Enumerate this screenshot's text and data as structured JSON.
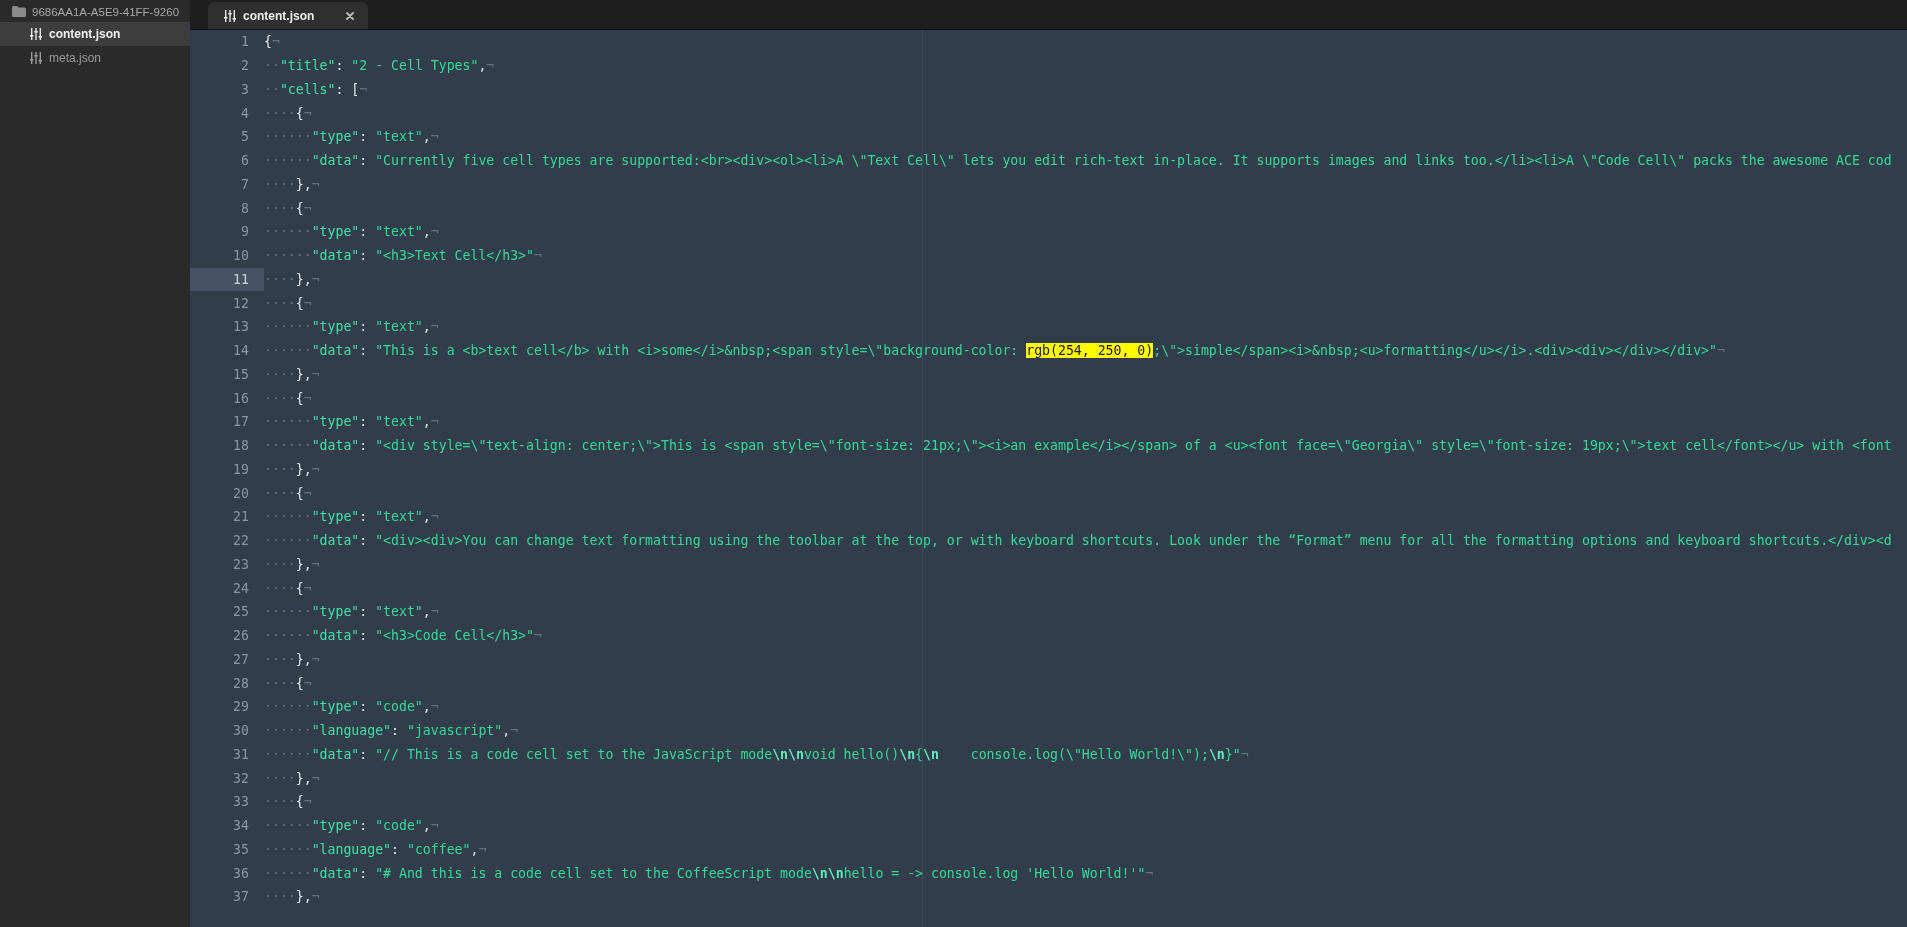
{
  "sidebar": {
    "folder": {
      "name": "9686AA1A-A5E9-41FF-9260"
    },
    "files": [
      {
        "name": "content.json",
        "selected": true
      },
      {
        "name": "meta.json",
        "selected": false
      }
    ]
  },
  "tabs": [
    {
      "label": "content.json",
      "selected": true
    }
  ],
  "editor": {
    "lines": [
      {
        "number": "1",
        "current": false,
        "tokens": [
          {
            "kind": "punct",
            "text": "{"
          },
          {
            "kind": "eol",
            "text": "¬"
          }
        ]
      },
      {
        "number": "2",
        "current": false,
        "tokens": [
          {
            "kind": "space",
            "text": "··"
          },
          {
            "kind": "key",
            "text": "\"title\""
          },
          {
            "kind": "punct",
            "text": ": "
          },
          {
            "kind": "string",
            "text": "\"2 - Cell Types\""
          },
          {
            "kind": "punct",
            "text": ","
          },
          {
            "kind": "eol",
            "text": "¬"
          }
        ]
      },
      {
        "number": "3",
        "current": false,
        "tokens": [
          {
            "kind": "space",
            "text": "··"
          },
          {
            "kind": "key",
            "text": "\"cells\""
          },
          {
            "kind": "punct",
            "text": ": ["
          },
          {
            "kind": "eol",
            "text": "¬"
          }
        ]
      },
      {
        "number": "4",
        "current": false,
        "tokens": [
          {
            "kind": "space",
            "text": "····"
          },
          {
            "kind": "punct",
            "text": "{"
          },
          {
            "kind": "eol",
            "text": "¬"
          }
        ]
      },
      {
        "number": "5",
        "current": false,
        "tokens": [
          {
            "kind": "space",
            "text": "······"
          },
          {
            "kind": "key",
            "text": "\"type\""
          },
          {
            "kind": "punct",
            "text": ": "
          },
          {
            "kind": "string",
            "text": "\"text\""
          },
          {
            "kind": "punct",
            "text": ","
          },
          {
            "kind": "eol",
            "text": "¬"
          }
        ]
      },
      {
        "number": "6",
        "current": false,
        "tokens": [
          {
            "kind": "space",
            "text": "······"
          },
          {
            "kind": "key",
            "text": "\"data\""
          },
          {
            "kind": "punct",
            "text": ": "
          },
          {
            "kind": "string",
            "text": "\"Currently five cell types are supported:<br><div><ol><li>A \\\"Text Cell\\\" lets you edit rich-text in-place. It supports images and links too.</li><li>A \\\"Code Cell\\\" packs the awesome ACE cod"
          }
        ]
      },
      {
        "number": "7",
        "current": false,
        "tokens": [
          {
            "kind": "space",
            "text": "····"
          },
          {
            "kind": "punct",
            "text": "},"
          },
          {
            "kind": "eol",
            "text": "¬"
          }
        ]
      },
      {
        "number": "8",
        "current": false,
        "tokens": [
          {
            "kind": "space",
            "text": "····"
          },
          {
            "kind": "punct",
            "text": "{"
          },
          {
            "kind": "eol",
            "text": "¬"
          }
        ]
      },
      {
        "number": "9",
        "current": false,
        "tokens": [
          {
            "kind": "space",
            "text": "······"
          },
          {
            "kind": "key",
            "text": "\"type\""
          },
          {
            "kind": "punct",
            "text": ": "
          },
          {
            "kind": "string",
            "text": "\"text\""
          },
          {
            "kind": "punct",
            "text": ","
          },
          {
            "kind": "eol",
            "text": "¬"
          }
        ]
      },
      {
        "number": "10",
        "current": false,
        "tokens": [
          {
            "kind": "space",
            "text": "······"
          },
          {
            "kind": "key",
            "text": "\"data\""
          },
          {
            "kind": "punct",
            "text": ": "
          },
          {
            "kind": "string",
            "text": "\"<h3>Text Cell</h3>\""
          },
          {
            "kind": "eol",
            "text": "¬"
          }
        ]
      },
      {
        "number": "11",
        "current": true,
        "tokens": [
          {
            "kind": "space",
            "text": "····"
          },
          {
            "kind": "punct",
            "text": "},"
          },
          {
            "kind": "eol",
            "text": "¬"
          }
        ]
      },
      {
        "number": "12",
        "current": false,
        "tokens": [
          {
            "kind": "space",
            "text": "····"
          },
          {
            "kind": "punct",
            "text": "{"
          },
          {
            "kind": "eol",
            "text": "¬"
          }
        ]
      },
      {
        "number": "13",
        "current": false,
        "tokens": [
          {
            "kind": "space",
            "text": "······"
          },
          {
            "kind": "key",
            "text": "\"type\""
          },
          {
            "kind": "punct",
            "text": ": "
          },
          {
            "kind": "string",
            "text": "\"text\""
          },
          {
            "kind": "punct",
            "text": ","
          },
          {
            "kind": "eol",
            "text": "¬"
          }
        ]
      },
      {
        "number": "14",
        "current": false,
        "tokens": [
          {
            "kind": "space",
            "text": "······"
          },
          {
            "kind": "key",
            "text": "\"data\""
          },
          {
            "kind": "punct",
            "text": ": "
          },
          {
            "kind": "string",
            "text": "\"This is a <b>text cell</b> with <i>some</i>&nbsp;<span style=\\\"background-color: "
          },
          {
            "kind": "highlight",
            "text": "rgb(254, 250, 0)"
          },
          {
            "kind": "string",
            "text": ";\\\">simple</span><i>&nbsp;<u>formatting</u></i>.<div><div></div></div>\""
          },
          {
            "kind": "eol",
            "text": "¬"
          }
        ]
      },
      {
        "number": "15",
        "current": false,
        "tokens": [
          {
            "kind": "space",
            "text": "····"
          },
          {
            "kind": "punct",
            "text": "},"
          },
          {
            "kind": "eol",
            "text": "¬"
          }
        ]
      },
      {
        "number": "16",
        "current": false,
        "tokens": [
          {
            "kind": "space",
            "text": "····"
          },
          {
            "kind": "punct",
            "text": "{"
          },
          {
            "kind": "eol",
            "text": "¬"
          }
        ]
      },
      {
        "number": "17",
        "current": false,
        "tokens": [
          {
            "kind": "space",
            "text": "······"
          },
          {
            "kind": "key",
            "text": "\"type\""
          },
          {
            "kind": "punct",
            "text": ": "
          },
          {
            "kind": "string",
            "text": "\"text\""
          },
          {
            "kind": "punct",
            "text": ","
          },
          {
            "kind": "eol",
            "text": "¬"
          }
        ]
      },
      {
        "number": "18",
        "current": false,
        "tokens": [
          {
            "kind": "space",
            "text": "······"
          },
          {
            "kind": "key",
            "text": "\"data\""
          },
          {
            "kind": "punct",
            "text": ": "
          },
          {
            "kind": "string",
            "text": "\"<div style=\\\"text-align: center;\\\">This is <span style=\\\"font-size: 21px;\\\"><i>an example</i></span> of a <u><font face=\\\"Georgia\\\" style=\\\"font-size: 19px;\\\">text cell</font></u> with <font"
          }
        ]
      },
      {
        "number": "19",
        "current": false,
        "tokens": [
          {
            "kind": "space",
            "text": "····"
          },
          {
            "kind": "punct",
            "text": "},"
          },
          {
            "kind": "eol",
            "text": "¬"
          }
        ]
      },
      {
        "number": "20",
        "current": false,
        "tokens": [
          {
            "kind": "space",
            "text": "····"
          },
          {
            "kind": "punct",
            "text": "{"
          },
          {
            "kind": "eol",
            "text": "¬"
          }
        ]
      },
      {
        "number": "21",
        "current": false,
        "tokens": [
          {
            "kind": "space",
            "text": "······"
          },
          {
            "kind": "key",
            "text": "\"type\""
          },
          {
            "kind": "punct",
            "text": ": "
          },
          {
            "kind": "string",
            "text": "\"text\""
          },
          {
            "kind": "punct",
            "text": ","
          },
          {
            "kind": "eol",
            "text": "¬"
          }
        ]
      },
      {
        "number": "22",
        "current": false,
        "tokens": [
          {
            "kind": "space",
            "text": "······"
          },
          {
            "kind": "key",
            "text": "\"data\""
          },
          {
            "kind": "punct",
            "text": ": "
          },
          {
            "kind": "string",
            "text": "\"<div><div>You can change text formatting using the toolbar at the top, or with keyboard shortcuts. Look under the “Format” menu for all the formatting options and keyboard shortcuts.</div><d"
          }
        ]
      },
      {
        "number": "23",
        "current": false,
        "tokens": [
          {
            "kind": "space",
            "text": "····"
          },
          {
            "kind": "punct",
            "text": "},"
          },
          {
            "kind": "eol",
            "text": "¬"
          }
        ]
      },
      {
        "number": "24",
        "current": false,
        "tokens": [
          {
            "kind": "space",
            "text": "····"
          },
          {
            "kind": "punct",
            "text": "{"
          },
          {
            "kind": "eol",
            "text": "¬"
          }
        ]
      },
      {
        "number": "25",
        "current": false,
        "tokens": [
          {
            "kind": "space",
            "text": "······"
          },
          {
            "kind": "key",
            "text": "\"type\""
          },
          {
            "kind": "punct",
            "text": ": "
          },
          {
            "kind": "string",
            "text": "\"text\""
          },
          {
            "kind": "punct",
            "text": ","
          },
          {
            "kind": "eol",
            "text": "¬"
          }
        ]
      },
      {
        "number": "26",
        "current": false,
        "tokens": [
          {
            "kind": "space",
            "text": "······"
          },
          {
            "kind": "key",
            "text": "\"data\""
          },
          {
            "kind": "punct",
            "text": ": "
          },
          {
            "kind": "string",
            "text": "\"<h3>Code Cell</h3>\""
          },
          {
            "kind": "eol",
            "text": "¬"
          }
        ]
      },
      {
        "number": "27",
        "current": false,
        "tokens": [
          {
            "kind": "space",
            "text": "····"
          },
          {
            "kind": "punct",
            "text": "},"
          },
          {
            "kind": "eol",
            "text": "¬"
          }
        ]
      },
      {
        "number": "28",
        "current": false,
        "tokens": [
          {
            "kind": "space",
            "text": "····"
          },
          {
            "kind": "punct",
            "text": "{"
          },
          {
            "kind": "eol",
            "text": "¬"
          }
        ]
      },
      {
        "number": "29",
        "current": false,
        "tokens": [
          {
            "kind": "space",
            "text": "······"
          },
          {
            "kind": "key",
            "text": "\"type\""
          },
          {
            "kind": "punct",
            "text": ": "
          },
          {
            "kind": "string",
            "text": "\"code\""
          },
          {
            "kind": "punct",
            "text": ","
          },
          {
            "kind": "eol",
            "text": "¬"
          }
        ]
      },
      {
        "number": "30",
        "current": false,
        "tokens": [
          {
            "kind": "space",
            "text": "······"
          },
          {
            "kind": "key",
            "text": "\"language\""
          },
          {
            "kind": "punct",
            "text": ": "
          },
          {
            "kind": "string",
            "text": "\"javascript\""
          },
          {
            "kind": "punct",
            "text": ","
          },
          {
            "kind": "eol",
            "text": "¬"
          }
        ]
      },
      {
        "number": "31",
        "current": false,
        "tokens": [
          {
            "kind": "space",
            "text": "······"
          },
          {
            "kind": "key",
            "text": "\"data\""
          },
          {
            "kind": "punct",
            "text": ": "
          },
          {
            "kind": "string",
            "text": "\"// This is a code cell set to the JavaScript mode"
          },
          {
            "kind": "escape",
            "text": "\\n\\n"
          },
          {
            "kind": "string",
            "text": "void hello()"
          },
          {
            "kind": "escape",
            "text": "\\n"
          },
          {
            "kind": "string",
            "text": "{"
          },
          {
            "kind": "escape",
            "text": "\\n"
          },
          {
            "kind": "string",
            "text": "    console.log(\\\"Hello World!\\\");"
          },
          {
            "kind": "escape",
            "text": "\\n"
          },
          {
            "kind": "string",
            "text": "}\""
          },
          {
            "kind": "eol",
            "text": "¬"
          }
        ]
      },
      {
        "number": "32",
        "current": false,
        "tokens": [
          {
            "kind": "space",
            "text": "····"
          },
          {
            "kind": "punct",
            "text": "},"
          },
          {
            "kind": "eol",
            "text": "¬"
          }
        ]
      },
      {
        "number": "33",
        "current": false,
        "tokens": [
          {
            "kind": "space",
            "text": "····"
          },
          {
            "kind": "punct",
            "text": "{"
          },
          {
            "kind": "eol",
            "text": "¬"
          }
        ]
      },
      {
        "number": "34",
        "current": false,
        "tokens": [
          {
            "kind": "space",
            "text": "······"
          },
          {
            "kind": "key",
            "text": "\"type\""
          },
          {
            "kind": "punct",
            "text": ": "
          },
          {
            "kind": "string",
            "text": "\"code\""
          },
          {
            "kind": "punct",
            "text": ","
          },
          {
            "kind": "eol",
            "text": "¬"
          }
        ]
      },
      {
        "number": "35",
        "current": false,
        "tokens": [
          {
            "kind": "space",
            "text": "······"
          },
          {
            "kind": "key",
            "text": "\"language\""
          },
          {
            "kind": "punct",
            "text": ": "
          },
          {
            "kind": "string",
            "text": "\"coffee\""
          },
          {
            "kind": "punct",
            "text": ","
          },
          {
            "kind": "eol",
            "text": "¬"
          }
        ]
      },
      {
        "number": "36",
        "current": false,
        "tokens": [
          {
            "kind": "space",
            "text": "······"
          },
          {
            "kind": "key",
            "text": "\"data\""
          },
          {
            "kind": "punct",
            "text": ": "
          },
          {
            "kind": "string",
            "text": "\"# And this is a code cell set to the CoffeeScript mode"
          },
          {
            "kind": "escape",
            "text": "\\n\\n"
          },
          {
            "kind": "string",
            "text": "hello = -> console.log 'Hello World!'\""
          },
          {
            "kind": "eol",
            "text": "¬"
          }
        ]
      },
      {
        "number": "37",
        "current": false,
        "tokens": [
          {
            "kind": "space",
            "text": "····"
          },
          {
            "kind": "punct",
            "text": "},"
          },
          {
            "kind": "eol",
            "text": "¬"
          }
        ]
      }
    ]
  }
}
